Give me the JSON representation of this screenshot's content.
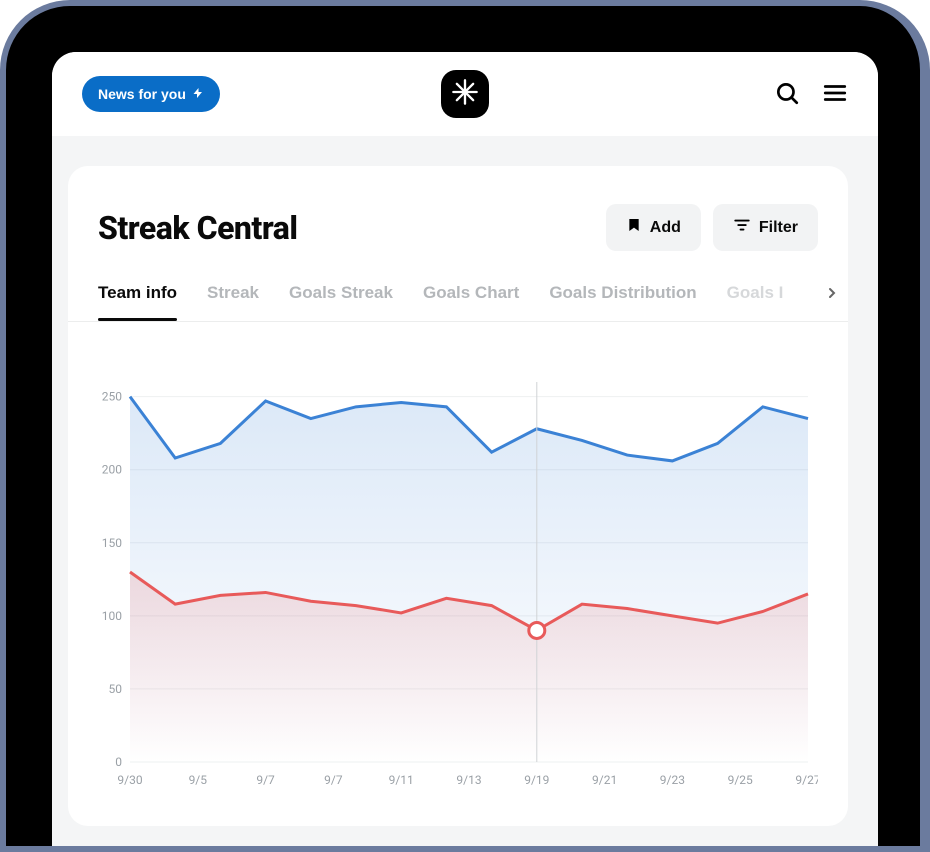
{
  "header": {
    "news_label": "News for you"
  },
  "page": {
    "title": "Streak Central",
    "add_label": "Add",
    "filter_label": "Filter"
  },
  "tabs": [
    {
      "label": "Team info",
      "active": true
    },
    {
      "label": "Streak",
      "active": false
    },
    {
      "label": "Goals Streak",
      "active": false
    },
    {
      "label": "Goals Chart",
      "active": false
    },
    {
      "label": "Goals Distribution",
      "active": false
    },
    {
      "label": "Goals I",
      "active": false,
      "partial": true
    }
  ],
  "chart_data": {
    "type": "line",
    "categories": [
      "9/30",
      "9/5",
      "9/7",
      "9/7",
      "9/11",
      "9/13",
      "9/19",
      "9/21",
      "9/23",
      "9/25",
      "9/27"
    ],
    "y_ticks": [
      0,
      50,
      100,
      150,
      200,
      250
    ],
    "ylim": [
      0,
      260
    ],
    "cursor_x_index": 6,
    "cursor_series": "red",
    "series": [
      {
        "name": "blue",
        "color": "#3b82d5",
        "values": [
          250,
          208,
          218,
          247,
          235,
          243,
          246,
          243,
          212,
          228,
          220,
          210,
          206,
          218,
          243,
          235
        ]
      },
      {
        "name": "red",
        "color": "#e85a5a",
        "values": [
          130,
          108,
          114,
          116,
          110,
          107,
          102,
          112,
          107,
          90,
          108,
          105,
          100,
          95,
          103,
          115
        ]
      }
    ],
    "title": "",
    "xlabel": "",
    "ylabel": ""
  }
}
